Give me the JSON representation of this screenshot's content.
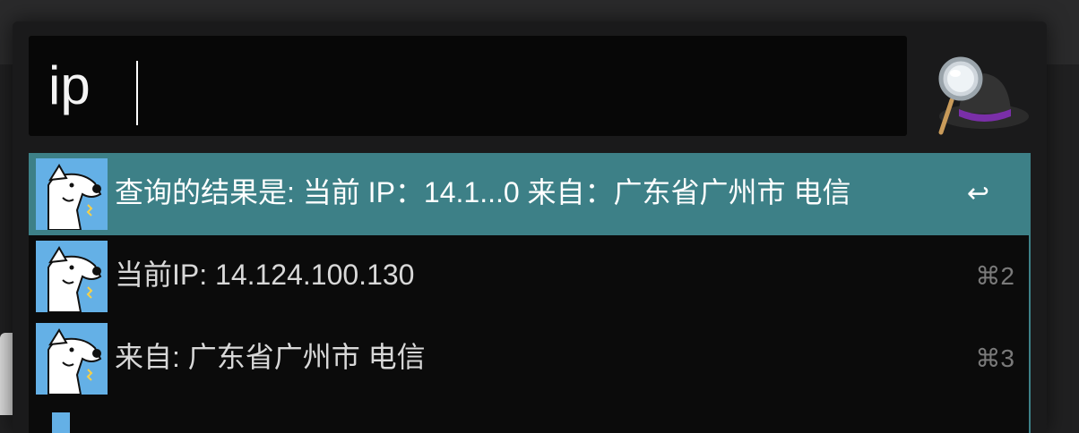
{
  "search": {
    "query": "ip"
  },
  "results": [
    {
      "title": "查询的结果是: 当前 IP：14.1...0 来自：广东省广州市 电信",
      "shortcut": "↩",
      "selected": true
    },
    {
      "title": "当前IP: 14.124.100.130",
      "shortcut": "⌘2",
      "selected": false
    },
    {
      "title": "来自: 广东省广州市 电信",
      "shortcut": "⌘3",
      "selected": false
    }
  ],
  "colors": {
    "selection": "#3d8087",
    "icon_bg": "#64b0e6",
    "launcher_bg": "#1a1a1b"
  },
  "icons": {
    "app_logo": "magnifier-hat-icon",
    "result_icon": "dog-icon"
  }
}
